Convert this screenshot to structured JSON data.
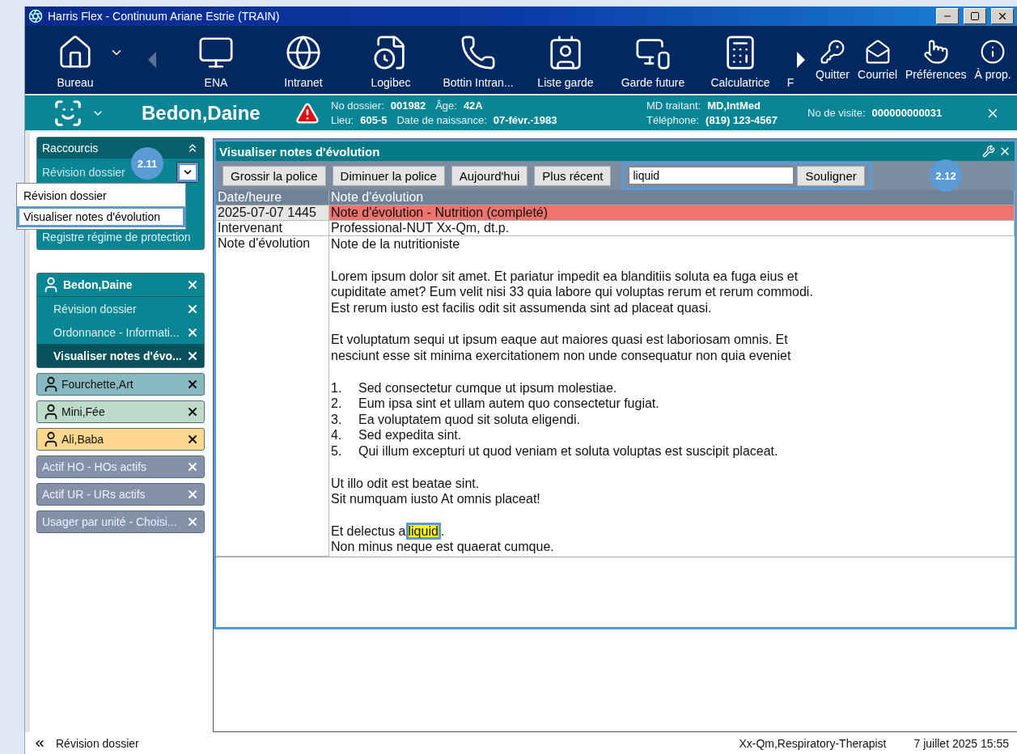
{
  "window": {
    "title": "Harris Flex - Continuum Ariane Estrie (TRAIN)"
  },
  "toolbar": {
    "launchers": [
      {
        "label": "Bureau",
        "menu": true
      },
      {
        "label": "ENA",
        "menu": false
      },
      {
        "label": "Intranet",
        "menu": false
      },
      {
        "label": "Logibec",
        "menu": false
      },
      {
        "label": "Bottin Intran...",
        "menu": false
      },
      {
        "label": "Liste garde",
        "menu": false
      },
      {
        "label": "Garde future",
        "menu": false
      },
      {
        "label": "Calculatrice",
        "menu": false
      },
      {
        "label": "F",
        "menu": false
      }
    ],
    "utilities": [
      "Quitter",
      "Courriel",
      "Préférences",
      "À prop."
    ]
  },
  "patient_bar": {
    "name": "Bedon,Daine",
    "alert": true,
    "info_columns": [
      [
        [
          {
            "label": "No dossier:",
            "value": "001982"
          },
          {
            "label": "Âge:",
            "value": "42A"
          }
        ],
        [
          {
            "label": "Lieu:",
            "value": "605-5"
          },
          {
            "label": "Date de naissance:",
            "value": "07-févr.-1983"
          }
        ]
      ],
      [
        [
          {
            "label": "MD traitant:",
            "value": "MD,IntMed"
          }
        ],
        [
          {
            "label": "Téléphone:",
            "value": "(819) 123-4567"
          }
        ]
      ],
      [
        [
          {
            "label": "No de visite:",
            "value": "000000000031"
          }
        ]
      ]
    ]
  },
  "shortcuts": {
    "title": "Raccourcis",
    "current": {
      "label": "Révision dossier",
      "annotated": true,
      "callout": "2.11"
    },
    "menu": [
      {
        "label": "Révision dossier",
        "annotated": false
      },
      {
        "label": "Visualiser notes d'évolution",
        "annotated": true
      }
    ],
    "items": [
      "Registre régime de protection"
    ]
  },
  "open_patient": {
    "name": "Bedon,Daine",
    "items": [
      {
        "label": "Révision dossier",
        "selected": false
      },
      {
        "label": "Ordonnance - Informati...",
        "selected": false
      },
      {
        "label": "Visualiser notes d'évo...",
        "selected": true
      }
    ]
  },
  "other_patients": [
    {
      "name": "Fourchette,Art",
      "color": "#86b9c0"
    },
    {
      "name": "Mini,Fée",
      "color": "#bddbca"
    },
    {
      "name": "Ali,Baba",
      "color": "#fed88f"
    }
  ],
  "lists": [
    "Actif HO - HOs actifs",
    "Actif UR - URs actifs",
    "Usager par unité - Choisi..."
  ],
  "notes_panel": {
    "title": "Visualiser notes d'évolution",
    "annotated": true,
    "buttons": [
      "Grossir la police",
      "Diminuer la police",
      "Aujourd'hui",
      "Plus récent"
    ],
    "search": {
      "value": "liquid",
      "button": "Souligner",
      "annotated": true,
      "callout": "2.12"
    },
    "columns": [
      "Date/heure",
      "Note d'évolution"
    ],
    "date": "2025-07-07 1445",
    "note_title": "Note d'évolution - Nutrition (completé)",
    "author_label": "Intervenant",
    "author": "Professional-NUT Xx-Qm, dt.p.",
    "body_label": "Note d'évolution",
    "body": [
      [
        {
          "kind": "text",
          "text": "Note de la nutritioniste"
        }
      ],
      [
        {
          "kind": "text",
          "text": "Lorem ipsum dolor sit amet. Et pariatur impedit ea blanditiis soluta ea fuga eius et cupiditate amet? Eum velit nisi 33 quia labore qui voluptas rerum et rerum commodi. Est rerum iusto est facilis odit sit assumenda sint ad placeat quasi."
        }
      ],
      [
        {
          "kind": "text",
          "text": "Et voluptatum sequi ut ipsum eaque aut maiores quasi est laboriosam omnis. Et nesciunt esse sit minima exercitationem non unde consequatur non quia eveniet"
        }
      ],
      [
        {
          "kind": "list",
          "items": [
            {
              "number": "1.",
              "text": "Sed consectetur cumque ut ipsum molestiae."
            },
            {
              "number": "2.",
              "text": "Eum ipsa sint et ullam autem quo consectetur fugiat."
            },
            {
              "number": "3.",
              "text": "Ea voluptatem quod sit soluta eligendi."
            },
            {
              "number": "4.",
              "text": "Sed expedita sint."
            },
            {
              "number": "5.",
              "text": "Qui illum excepturi ut quod veniam et soluta voluptas est suscipit placeat."
            }
          ]
        }
      ],
      [
        {
          "kind": "text",
          "text": "Ut illo odit est beatae sint."
        },
        {
          "kind": "text",
          "text": "Sit numquam iusto At omnis placeat!"
        }
      ],
      [
        {
          "kind": "segments",
          "segments": [
            {
              "text": "Et delectus a",
              "highlighted": false
            },
            {
              "text": "liquid",
              "highlighted": true,
              "annotated": true
            },
            {
              "text": ".",
              "highlighted": false
            }
          ]
        },
        {
          "kind": "text",
          "text": "Non minus neque est quaerat cumque."
        }
      ]
    ]
  },
  "status_bar": {
    "back": "Révision dossier",
    "user": "Xx-Qm,Respiratory-Therapist",
    "datetime": "7 juillet 2025 15:55"
  }
}
